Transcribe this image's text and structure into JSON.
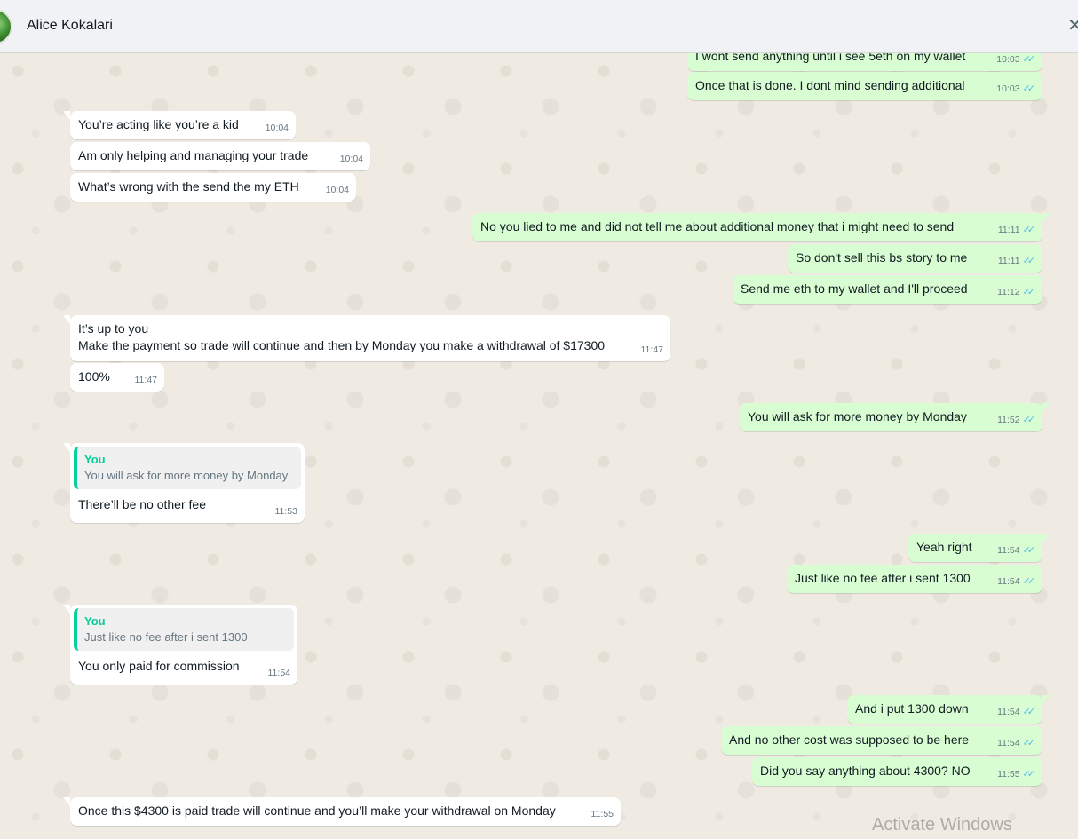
{
  "header": {
    "contact_name": "Alice Kokalari"
  },
  "messages": [
    {
      "dir": "out",
      "text": "I wont send anything until i see 5eth on my wallet",
      "time": "10:03"
    },
    {
      "dir": "out",
      "text": "Once that is done. I dont mind sending additional",
      "time": "10:03"
    },
    {
      "dir": "in",
      "text": "You’re acting like you’re a kid",
      "time": "10:04"
    },
    {
      "dir": "in",
      "text": "Am only helping and managing your trade",
      "time": "10:04"
    },
    {
      "dir": "in",
      "text": "What’s wrong with the send the my ETH",
      "time": "10:04"
    },
    {
      "dir": "out",
      "text": "No you lied to me and did not tell me about additional money that i might need to send",
      "time": "11:11"
    },
    {
      "dir": "out",
      "text": "So don't sell this bs story to me",
      "time": "11:11"
    },
    {
      "dir": "out",
      "text": "Send me eth to my wallet and I'll proceed",
      "time": "11:12"
    },
    {
      "dir": "in",
      "line1": "It’s up to you",
      "line2": "Make the payment so trade will continue and then by Monday you make a withdrawal of $17300",
      "time": "11:47"
    },
    {
      "dir": "in",
      "text": "100%",
      "time": "11:47"
    },
    {
      "dir": "out",
      "text": "You will ask for more money by Monday",
      "time": "11:52"
    },
    {
      "dir": "in",
      "quote_author": "You",
      "quote_text": "You will ask for more money by Monday",
      "text": "There’ll be no other fee",
      "time": "11:53"
    },
    {
      "dir": "out",
      "text": "Yeah right",
      "time": "11:54"
    },
    {
      "dir": "out",
      "text": "Just like no fee after i sent 1300",
      "time": "11:54"
    },
    {
      "dir": "in",
      "quote_author": "You",
      "quote_text": "Just like no fee after i sent 1300",
      "text": "You only paid for commission",
      "time": "11:54"
    },
    {
      "dir": "out",
      "text": "And i put 1300 down",
      "time": "11:54"
    },
    {
      "dir": "out",
      "text": "And no other cost was supposed to be here",
      "time": "11:54"
    },
    {
      "dir": "out",
      "text": "Did you say anything about 4300? NO",
      "time": "11:55"
    },
    {
      "dir": "in",
      "text": "Once this $4300 is paid trade will continue and you’ll make your withdrawal on Monday",
      "time": "11:55"
    }
  ],
  "watermark": "Activate Windows",
  "colors": {
    "outgoing": "#d9fdd3",
    "incoming": "#ffffff",
    "read_ticks": "#53bdeb",
    "quote_bar": "#06cf9c",
    "chat_bg": "#efeae2"
  }
}
